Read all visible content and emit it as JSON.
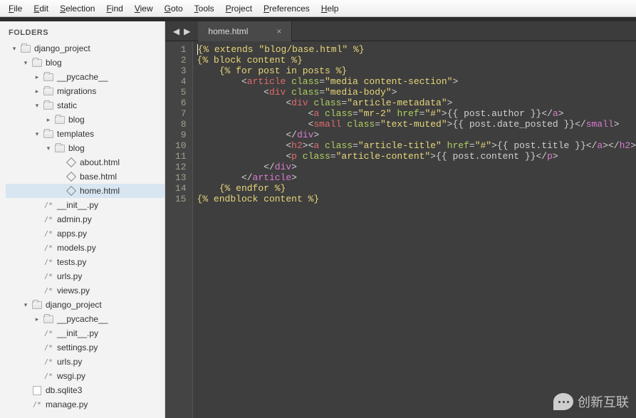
{
  "menu": [
    "File",
    "Edit",
    "Selection",
    "Find",
    "View",
    "Goto",
    "Tools",
    "Project",
    "Preferences",
    "Help"
  ],
  "sidebar": {
    "header": "FOLDERS",
    "tree": [
      {
        "d": 0,
        "disc": "▾",
        "icon": "folder",
        "label": "django_project"
      },
      {
        "d": 1,
        "disc": "▾",
        "icon": "folder",
        "label": "blog"
      },
      {
        "d": 2,
        "disc": "▸",
        "icon": "folder",
        "label": "__pycache__"
      },
      {
        "d": 2,
        "disc": "▸",
        "icon": "folder",
        "label": "migrations"
      },
      {
        "d": 2,
        "disc": "▾",
        "icon": "folder",
        "label": "static"
      },
      {
        "d": 3,
        "disc": "▸",
        "icon": "folder",
        "label": "blog"
      },
      {
        "d": 2,
        "disc": "▾",
        "icon": "folder",
        "label": "templates"
      },
      {
        "d": 3,
        "disc": "▾",
        "icon": "folder",
        "label": "blog"
      },
      {
        "d": 4,
        "disc": "",
        "icon": "diamond",
        "label": "about.html"
      },
      {
        "d": 4,
        "disc": "",
        "icon": "diamond",
        "label": "base.html"
      },
      {
        "d": 4,
        "disc": "",
        "icon": "diamond",
        "label": "home.html",
        "sel": true
      },
      {
        "d": 2,
        "disc": "",
        "icon": "comment",
        "label": "__init__.py"
      },
      {
        "d": 2,
        "disc": "",
        "icon": "comment",
        "label": "admin.py"
      },
      {
        "d": 2,
        "disc": "",
        "icon": "comment",
        "label": "apps.py"
      },
      {
        "d": 2,
        "disc": "",
        "icon": "comment",
        "label": "models.py"
      },
      {
        "d": 2,
        "disc": "",
        "icon": "comment",
        "label": "tests.py"
      },
      {
        "d": 2,
        "disc": "",
        "icon": "comment",
        "label": "urls.py"
      },
      {
        "d": 2,
        "disc": "",
        "icon": "comment",
        "label": "views.py"
      },
      {
        "d": 1,
        "disc": "▾",
        "icon": "folder",
        "label": "django_project"
      },
      {
        "d": 2,
        "disc": "▸",
        "icon": "folder",
        "label": "__pycache__"
      },
      {
        "d": 2,
        "disc": "",
        "icon": "comment",
        "label": "__init__.py"
      },
      {
        "d": 2,
        "disc": "",
        "icon": "comment",
        "label": "settings.py"
      },
      {
        "d": 2,
        "disc": "",
        "icon": "comment",
        "label": "urls.py"
      },
      {
        "d": 2,
        "disc": "",
        "icon": "comment",
        "label": "wsgi.py"
      },
      {
        "d": 1,
        "disc": "",
        "icon": "file",
        "label": "db.sqlite3"
      },
      {
        "d": 1,
        "disc": "",
        "icon": "comment",
        "label": "manage.py"
      }
    ]
  },
  "tab": {
    "name": "home.html",
    "close": "×"
  },
  "code": {
    "lines": [
      [
        [
          "txt",
          "{% extends \"blog/base.html\" %}"
        ]
      ],
      [
        [
          "txt",
          "{% block content %}"
        ]
      ],
      [
        [
          "txt",
          "    {% for post in posts %}"
        ]
      ],
      [
        [
          "punc",
          "        <"
        ],
        [
          "tag",
          "article"
        ],
        [
          "punc",
          " "
        ],
        [
          "attr",
          "class"
        ],
        [
          "op",
          "="
        ],
        [
          "txt",
          "\"media content-section\""
        ],
        [
          "punc",
          ">"
        ]
      ],
      [
        [
          "punc",
          "            <"
        ],
        [
          "tag",
          "div"
        ],
        [
          "punc",
          " "
        ],
        [
          "attr",
          "class"
        ],
        [
          "op",
          "="
        ],
        [
          "txt",
          "\"media-body\""
        ],
        [
          "punc",
          ">"
        ]
      ],
      [
        [
          "punc",
          "                <"
        ],
        [
          "tag",
          "div"
        ],
        [
          "punc",
          " "
        ],
        [
          "attr",
          "class"
        ],
        [
          "op",
          "="
        ],
        [
          "txt",
          "\"article-metadata\""
        ],
        [
          "punc",
          ">"
        ]
      ],
      [
        [
          "punc",
          "                    <"
        ],
        [
          "tag",
          "a"
        ],
        [
          "punc",
          " "
        ],
        [
          "attr",
          "class"
        ],
        [
          "op",
          "="
        ],
        [
          "txt",
          "\"mr-2\""
        ],
        [
          "punc",
          " "
        ],
        [
          "attr",
          "href"
        ],
        [
          "op",
          "="
        ],
        [
          "txt",
          "\"#\""
        ],
        [
          "punc",
          ">"
        ],
        [
          "punc",
          "{{ post.author }}"
        ],
        [
          "punc",
          "</"
        ],
        [
          "endp",
          "a"
        ],
        [
          "punc",
          ">"
        ]
      ],
      [
        [
          "punc",
          "                    <"
        ],
        [
          "tag",
          "small"
        ],
        [
          "punc",
          " "
        ],
        [
          "attr",
          "class"
        ],
        [
          "op",
          "="
        ],
        [
          "txt",
          "\"text-muted\""
        ],
        [
          "punc",
          ">"
        ],
        [
          "punc",
          "{{ post.date_posted }}"
        ],
        [
          "punc",
          "</"
        ],
        [
          "endp",
          "small"
        ],
        [
          "punc",
          ">"
        ]
      ],
      [
        [
          "punc",
          "                </"
        ],
        [
          "endp",
          "div"
        ],
        [
          "punc",
          ">"
        ]
      ],
      [
        [
          "punc",
          "                <"
        ],
        [
          "tag",
          "h2"
        ],
        [
          "punc",
          "><"
        ],
        [
          "tag",
          "a"
        ],
        [
          "punc",
          " "
        ],
        [
          "attr",
          "class"
        ],
        [
          "op",
          "="
        ],
        [
          "txt",
          "\"article-title\""
        ],
        [
          "punc",
          " "
        ],
        [
          "attr",
          "href"
        ],
        [
          "op",
          "="
        ],
        [
          "txt",
          "\"#\""
        ],
        [
          "punc",
          ">"
        ],
        [
          "punc",
          "{{ post.title }}"
        ],
        [
          "punc",
          "</"
        ],
        [
          "endp",
          "a"
        ],
        [
          "punc",
          "></"
        ],
        [
          "endp",
          "h2"
        ],
        [
          "punc",
          ">"
        ]
      ],
      [
        [
          "punc",
          "                <"
        ],
        [
          "tag",
          "p"
        ],
        [
          "punc",
          " "
        ],
        [
          "attr",
          "class"
        ],
        [
          "op",
          "="
        ],
        [
          "txt",
          "\"article-content\""
        ],
        [
          "punc",
          ">"
        ],
        [
          "punc",
          "{{ post.content }}"
        ],
        [
          "punc",
          "</"
        ],
        [
          "endp",
          "p"
        ],
        [
          "punc",
          ">"
        ]
      ],
      [
        [
          "punc",
          "            </"
        ],
        [
          "endp",
          "div"
        ],
        [
          "punc",
          ">"
        ]
      ],
      [
        [
          "punc",
          "        </"
        ],
        [
          "endp",
          "article"
        ],
        [
          "punc",
          ">"
        ]
      ],
      [
        [
          "txt",
          "    {% endfor %}"
        ]
      ],
      [
        [
          "txt",
          "{% endblock content %}"
        ]
      ]
    ]
  },
  "watermark": "创新互联"
}
